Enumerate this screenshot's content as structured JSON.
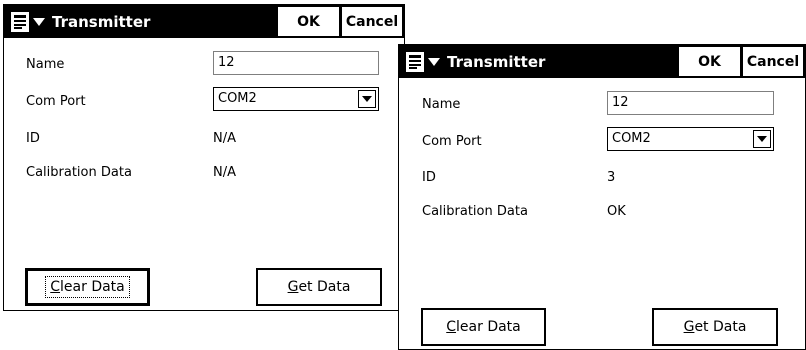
{
  "dialogs": [
    {
      "title": "Transmitter",
      "ok_label": "OK",
      "cancel_label": "Cancel",
      "name_label": "Name",
      "name_value": "12",
      "com_port_label": "Com Port",
      "com_port_value": "COM2",
      "id_label": "ID",
      "id_value": "N/A",
      "calibration_label": "Calibration Data",
      "calibration_value": "N/A",
      "clear_data_label": "Clear Data",
      "get_data_label": "Get Data"
    },
    {
      "title": "Transmitter",
      "ok_label": "OK",
      "cancel_label": "Cancel",
      "name_label": "Name",
      "name_value": "12",
      "com_port_label": "Com Port",
      "com_port_value": "COM2",
      "id_label": "ID",
      "id_value": "3",
      "calibration_label": "Calibration Data",
      "calibration_value": "OK",
      "clear_data_label": "Clear Data",
      "get_data_label": "Get Data"
    }
  ],
  "icons": {
    "start_menu": "windows-flag-icon",
    "dropdown": "chevron-down-icon"
  }
}
